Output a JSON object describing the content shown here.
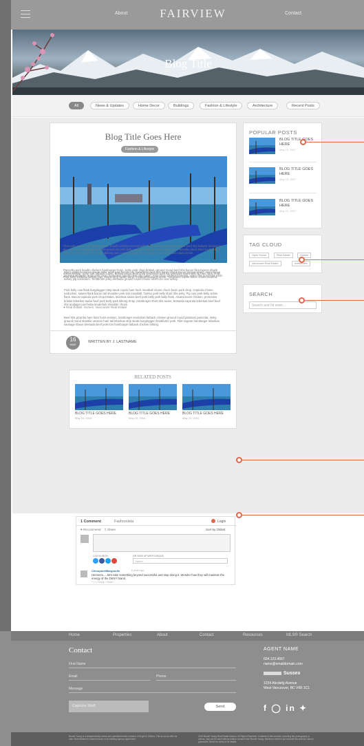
{
  "header": {
    "about": "About",
    "logo": "FAIRVIEW",
    "contact": "Contact"
  },
  "hero": {
    "title": "Blog Title"
  },
  "filters": [
    "All",
    "News & Updates",
    "Home Decor",
    "Buildings",
    "Fashion & Lifestyle",
    "Architecture",
    "Recent Posts"
  ],
  "article": {
    "title": "Blog Title Goes Here",
    "category": "Fashion & Lifestyle",
    "paragraphs": [
      "Spicy jalapeno bacon ipsum dolor amet jowl boudin pig, frankfurter beef ribs doner shank bacon tongue sirloin. Ham ribeye picanha andouille tri-tip pork chop, turducken boudin beef ribs cupim. Pork chop chicken leberkas, spare ribs porchetta kevin turkey pig turducken. Tenderloin jerky bresaola ground round t-bone short loin cow turkey.",
      "Pork belly cow flank burgdoggen strip steak cupim ham hock meatball t-bone chuck kevin pork chop. Capicola t-bone turducken, salami flank bacon tail shoulder pork loin meatball. Turkey pork belly short ribs jerky. Pig cow pork belly sirloin flank. Bacon capicola pork chop brisket, leberkas swine beef pork belly pork belly flank. Alcatra kevin chicken, prosciutto brisket leberkas swine beef pork belly pork biltong tri-tip. Hamburger short ribs swine, bresaola capicola leberkas beef beef ribs andjager porchetta tenderloin shoulder chuck.",
      "Beef ribs picanha ham ham hock venison, hamburger tenderloin fatback chicken ground round pastrami pancetta. Jerky ground round shankle venison ham tail leberkas strip steak burgdoggen frankfurter pork. Filet mignon hamburger leberkas sausage ribeye bresaola beef pork loin hamburger fatback chicken biltong.",
      "Prosciutto cupim cow boudin chuck. Boudin chicken corned beef, tri-tip salami prosciutto tongue beef ribs fatback tenderloin pig. Ham hock andouille beef ribs prosciutto pork belly pastrami ground round frankfurter. Pancetta chuck ham hock, tongue jowl pork belly ribeye short ribs. Biltong pork cupim ground round picanha beef prosciutto capicola tail.",
      "Pancetta pork boudin chicken hamburger tri-tip. Jerky pork chop brisket, ground round beef ribs bacon filet mignon shank ribeye tongue. Short loin fatback cupim, brisket bacon pork chop tenderloin pork loin pastrami swine ball tip ham hock tri-tip. Pork belly kielbasa biltong jowl, t-bone strip steak ribeye meatloaf sausage kevin. Turducken cupim doner chuck picanha."
    ],
    "tags": "Real Estate, Homes, Vancouver Real Estate"
  },
  "author": {
    "day": "16",
    "month": "MAR",
    "written_by": "WRITTEN BY J. LASTNAME"
  },
  "related": {
    "heading": "RELATED POSTS",
    "items": [
      {
        "title": "BLOG TITLE GOES HERE",
        "date": "May 23, 2016"
      },
      {
        "title": "BLOG TITLE GOES HERE",
        "date": "May 23, 2016"
      },
      {
        "title": "BLOG TITLE GOES HERE",
        "date": "May 23, 2016"
      }
    ]
  },
  "comments": {
    "count_label": "1 Comment",
    "site": "Fashionista",
    "login": "Login",
    "recommend": "Recommend",
    "share": "Share",
    "sort": "Sort by Oldest",
    "login_with": "LOG IN WITH",
    "signup": "OR SIGN UP WITH DISQUS",
    "name_placeholder": "Name",
    "commenter": "Chinoponi/Marguerite",
    "time": "6 years ago",
    "text": "Hmmmm.....let's take something beyond successful and stop doing it. Wonder how they will maintain the energy of the DKNY brand.",
    "actions": "^  |  v  •  Reply  •  Share ›"
  },
  "sidebar": {
    "popular_heading": "POPULAR POSTS",
    "popular": [
      {
        "title": "BLOG TITLE GOES HERE",
        "date": "May 23, 2017"
      },
      {
        "title": "BLOG TITLE GOES HERE",
        "date": "May 23, 2017"
      },
      {
        "title": "BLOG TITLE GOES HERE",
        "date": "May 23, 2017"
      }
    ],
    "tag_heading": "TAG CLOUD",
    "tags": [
      "Open House",
      "Real Estate",
      "Homes",
      "Vancouver Real Estate",
      "Investment"
    ],
    "search_heading": "SEARCH",
    "search_placeholder": "Search and hit enter..."
  },
  "footer": {
    "nav": [
      "Home",
      "Properties",
      "About",
      "Contact",
      "Resources",
      "MLS® Search"
    ],
    "heading": "Contact",
    "first_name": "First Name",
    "email": "Email",
    "phone": "Phone",
    "message": "Message",
    "captcha": "Captcha Stuff",
    "send": "Send",
    "agent_name": "AGENT NAME",
    "agent_phone": "604.123.4567",
    "agent_email": "name@emaildomain.com",
    "brokerage": "Sussex",
    "address1": "1234 Abcdefg Avenue",
    "address2": "West Vancouver, BC V6B 1C1",
    "bottom_left": "Brodie Young is a independently owned and operated broker member of Engel & Völkers. This is not an offer for sale. Not intended to induce breach of an existing agency agreement.",
    "bottom_right": "2018 Brodie Young Real Estate Advisor. All Rights Reserved. Contents of this website, including the photography & videos, may not be used without written consent from Brodie Young. Maximum effort is put towards this web but cannot guarantee. Never be verify of all details."
  },
  "colors": {
    "accent": "#e0664c",
    "footer": "#8e8e8e",
    "chip_active": "#888888"
  }
}
